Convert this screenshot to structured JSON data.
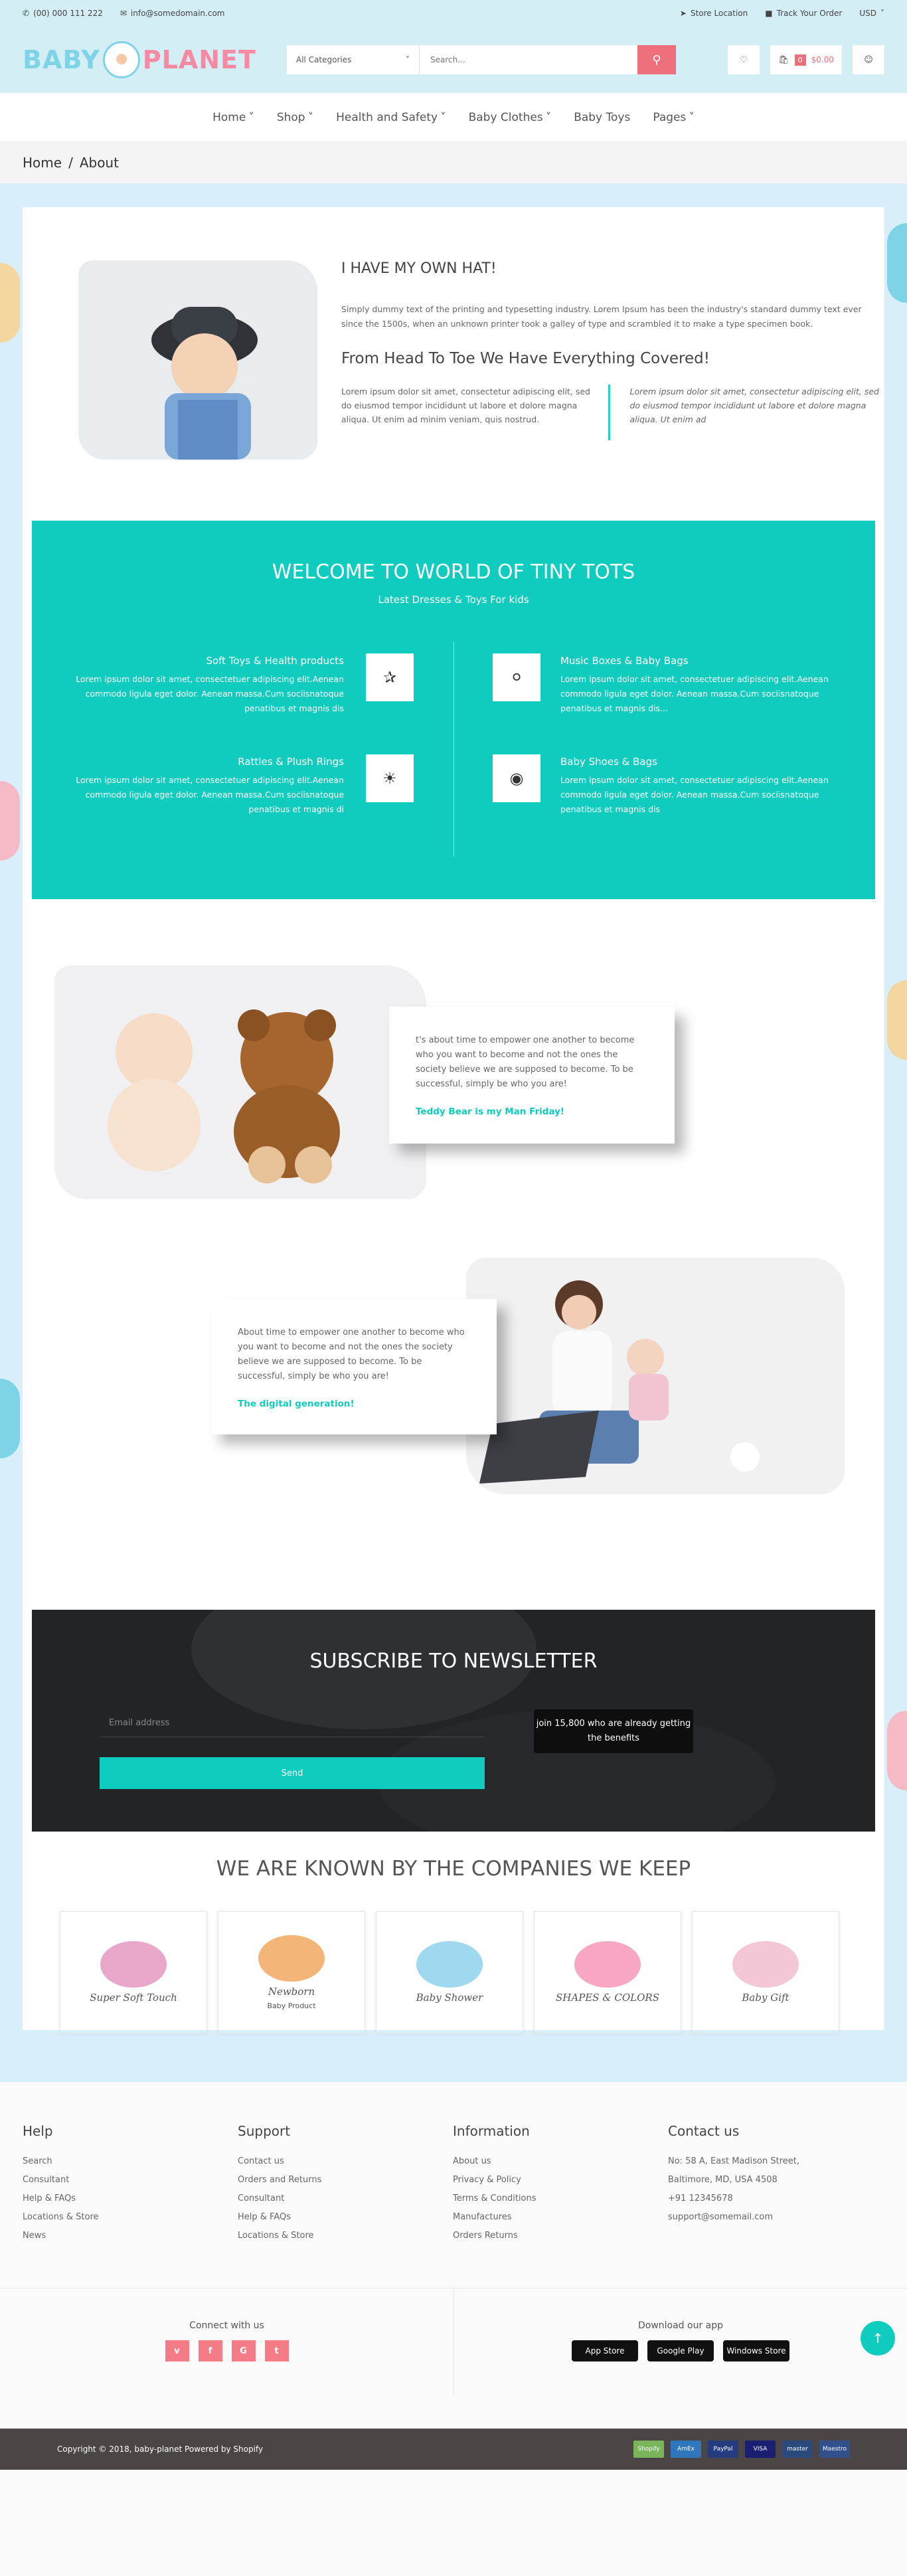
{
  "topbar": {
    "phone": "(00) 000 111 222",
    "email": "info@somedomain.com",
    "store_location": "Store Location",
    "track_order": "Track Your Order",
    "currency": "USD"
  },
  "header": {
    "logo_left": "BABY",
    "logo_right": "PLANET",
    "category_value": "All Categories",
    "search_placeholder": "Search...",
    "cart_count": "0",
    "cart_total": "$0.00"
  },
  "nav": {
    "items": [
      {
        "label": "Home",
        "has_dropdown": true
      },
      {
        "label": "Shop",
        "has_dropdown": true
      },
      {
        "label": "Health and Safety",
        "has_dropdown": true
      },
      {
        "label": "Baby Clothes",
        "has_dropdown": true
      },
      {
        "label": "Baby Toys",
        "has_dropdown": false
      },
      {
        "label": "Pages",
        "has_dropdown": true
      }
    ]
  },
  "breadcrumb": {
    "home": "Home",
    "separator": "/",
    "current": "About"
  },
  "about": {
    "title": "I HAVE MY OWN HAT!",
    "lead": "Simply dummy text of the printing and typesetting industry. Lorem Ipsum has been the industry's standard dummy text ever since the 1500s, when an unknown printer took a galley of type and scrambled it to make a type specimen book.",
    "subtitle": "From Head To Toe We Have Everything Covered!",
    "col_left": "Lorem ipsum dolor sit amet, consectetur adipiscing elit, sed do eiusmod tempor incididunt ut labore et dolore magna aliqua. Ut enim ad minim veniam, quis nostrud.",
    "col_right": "Lorem ipsum dolor sit amet, consectetur adipiscing elit, sed do eiusmod tempor incididunt ut labore et dolore magna aliqua. Ut enim ad"
  },
  "welcome": {
    "title": "WELCOME TO WORLD OF TINY TOTS",
    "subtitle": "Latest Dresses & Toys For kids",
    "features": [
      {
        "title": "Soft Toys & Health products",
        "text": "Lorem ipsum dolor sit amet, consectetuer adipiscing elit.Aenean commodo ligula eget dolor. Aenean massa.Cum sociisnatoque penatibus et magnis dis",
        "icon": "pinwheel-icon"
      },
      {
        "title": "Music Boxes & Baby Bags",
        "text": "Lorem ipsum dolor sit amet, consectetuer adipiscing elit.Aenean commodo ligula eget dolor. Aenean massa.Cum sociisnatoque penatibus et magnis dis...",
        "icon": "bicycle-icon"
      },
      {
        "title": "Rattles & Plush Rings",
        "text": "Lorem ipsum dolor sit amet, consectetuer adipiscing elit.Aenean commodo ligula eget dolor. Aenean massa.Cum sociisnatoque penatibus et magnis di",
        "icon": "sun-icon"
      },
      {
        "title": "Baby Shoes & Bags",
        "text": "Lorem ipsum dolor sit amet, consectetuer adipiscing elit.Aenean commodo ligula eget dolor. Aenean massa.Cum sociisnatoque penatibus et magnis dis",
        "icon": "stroller-icon"
      }
    ]
  },
  "teddy": {
    "text": "t's about time to empower one another to become who you want to become and not the ones the society believe we are supposed to become. To be successful, simply be who you are!",
    "cta": "Teddy Bear is my Man Friday!"
  },
  "digital": {
    "text": "About time to empower one another to become who you want to become and not the ones the society believe we are supposed to become. To be successful, simply be who you are!",
    "cta": "The digital generation!"
  },
  "newsletter": {
    "title": "SUBSCRIBE TO NEWSLETTER",
    "email_placeholder": "Email address",
    "send": "Send",
    "badge": "join 15,800 who are already getting the benefits"
  },
  "brands": {
    "title": "WE ARE KNOWN BY THE COMPANIES WE KEEP",
    "items": [
      {
        "name": "Super Soft Touch",
        "color": "#e8a7c9"
      },
      {
        "name": "Newborn",
        "sub": "Baby Product",
        "color": "#f4b678"
      },
      {
        "name": "Baby Shower",
        "color": "#9fd8ef"
      },
      {
        "name": "SHAPES & COLORS",
        "color": "#f7a7c4"
      },
      {
        "name": "Baby Gift",
        "color": "#f3c7d6"
      }
    ]
  },
  "footer": {
    "columns": [
      {
        "title": "Help",
        "links": [
          "Search",
          "Consultant",
          "Help & FAQs",
          "Locations & Store",
          "News"
        ]
      },
      {
        "title": "Support",
        "links": [
          "Contact us",
          "Orders and Returns",
          "Consultant",
          "Help & FAQs",
          "Locations & Store"
        ]
      },
      {
        "title": "Information",
        "links": [
          "About us",
          "Privacy & Policy",
          "Terms & Conditions",
          "Manufactures",
          "Orders Returns"
        ]
      },
      {
        "title": "Contact us",
        "links": [
          "No: 58 A, East Madison Street,",
          "Baltimore, MD, USA 4508",
          "+91 12345678",
          "support@somemail.com"
        ]
      }
    ],
    "connect": "Connect with us",
    "social": [
      "v",
      "f",
      "G",
      "t"
    ],
    "download": "Download our app",
    "apps": [
      "App Store",
      "Google Play",
      "Windows Store"
    ],
    "copyright": "Copyright © 2018, baby-planet Powered by Shopify",
    "payments": [
      {
        "label": "Shopify",
        "color": "#7ab55c"
      },
      {
        "label": "AmEx",
        "color": "#2e77bc"
      },
      {
        "label": "PayPal",
        "color": "#253b80"
      },
      {
        "label": "VISA",
        "color": "#1a1f71"
      },
      {
        "label": "master",
        "color": "#2a4a7d"
      },
      {
        "label": "Maestro",
        "color": "#31508c"
      }
    ]
  },
  "colors": {
    "accent": "#10ccbf",
    "pink": "#ee6f7c",
    "sky": "#d4eef5"
  }
}
